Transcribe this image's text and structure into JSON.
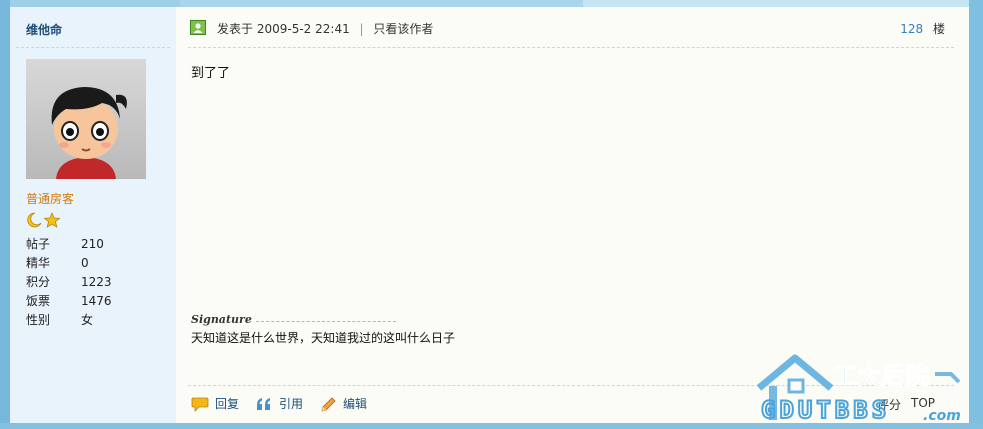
{
  "user": {
    "name": "维他命",
    "rank": "普通房客",
    "stats": [
      {
        "label": "帖子",
        "value": "210"
      },
      {
        "label": "精华",
        "value": "0"
      },
      {
        "label": "积分",
        "value": "1223"
      },
      {
        "label": "饭票",
        "value": "1476"
      },
      {
        "label": "性别",
        "value": "女"
      }
    ]
  },
  "post": {
    "posted_label": "发表于",
    "posted_time": "2009-5-2 22:41",
    "separator": "|",
    "only_author": "只看该作者",
    "floor_number": "128",
    "floor_unit": "楼",
    "content": "到了了",
    "signature_label": "Signature",
    "signature_text": "天知道这是什么世界，天知道我过的这叫什么日子"
  },
  "actions": {
    "reply": "回复",
    "quote": "引用",
    "edit": "编辑",
    "rate": "评分",
    "top": "TOP"
  },
  "watermark": {
    "cn": "工大后院",
    "en": "GDUTBBS",
    "dotcom": ".com"
  },
  "colors": {
    "frame": "#8bc4e2",
    "user_bg": "#e9f3fb",
    "post_bg": "#fbfcf6",
    "rank": "#d07b11",
    "link": "#1d4e79",
    "floor": "#3a7fbf"
  }
}
